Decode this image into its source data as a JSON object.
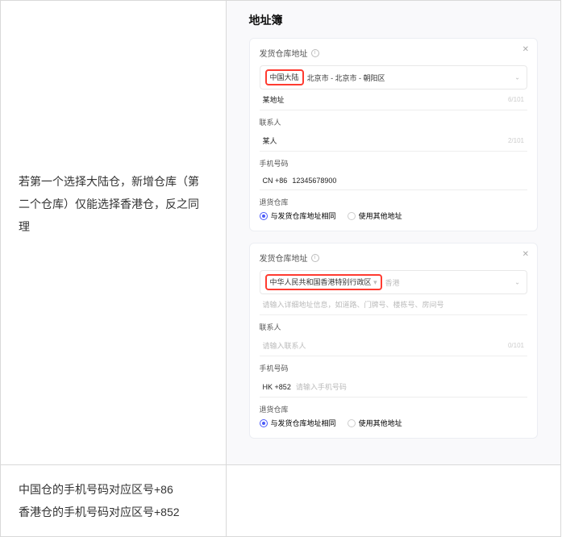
{
  "outer": {
    "row1": {
      "left_text": "若第一个选择大陆仓，新增仓库（第二个仓库）仅能选择香港仓，反之同理",
      "right": {
        "page_title": "地址簿",
        "panel1": {
          "title": "发货仓库地址",
          "region_highlight": "中国大陆",
          "region_rest": "北京市 - 北京市 - 朝阳区",
          "addr_value": "某地址",
          "addr_counter": "6/101",
          "contact_label": "联系人",
          "contact_value": "某人",
          "contact_counter": "2/101",
          "phone_label": "手机号码",
          "phone_prefix": "CN +86",
          "phone_value": "12345678900",
          "return_label": "退货仓库",
          "radio_same": "与发货仓库地址相同",
          "radio_other": "使用其他地址"
        },
        "panel2": {
          "title": "发货仓库地址",
          "region_highlight": "中华人民共和国香港特别行政区",
          "region_rest_placeholder": "香港",
          "addr_placeholder": "请输入详细地址信息，如道路、门牌号、楼栋号、房间号",
          "contact_label": "联系人",
          "contact_placeholder": "请输入联系人",
          "contact_counter": "0/101",
          "phone_label": "手机号码",
          "phone_prefix": "HK +852",
          "phone_placeholder": "请输入手机号码",
          "return_label": "退货仓库",
          "radio_same": "与发货仓库地址相同",
          "radio_other": "使用其他地址"
        }
      }
    },
    "row2": {
      "left_line1": "中国仓的手机号码对应区号+86",
      "left_line2": "香港仓的手机号码对应区号+852"
    }
  }
}
